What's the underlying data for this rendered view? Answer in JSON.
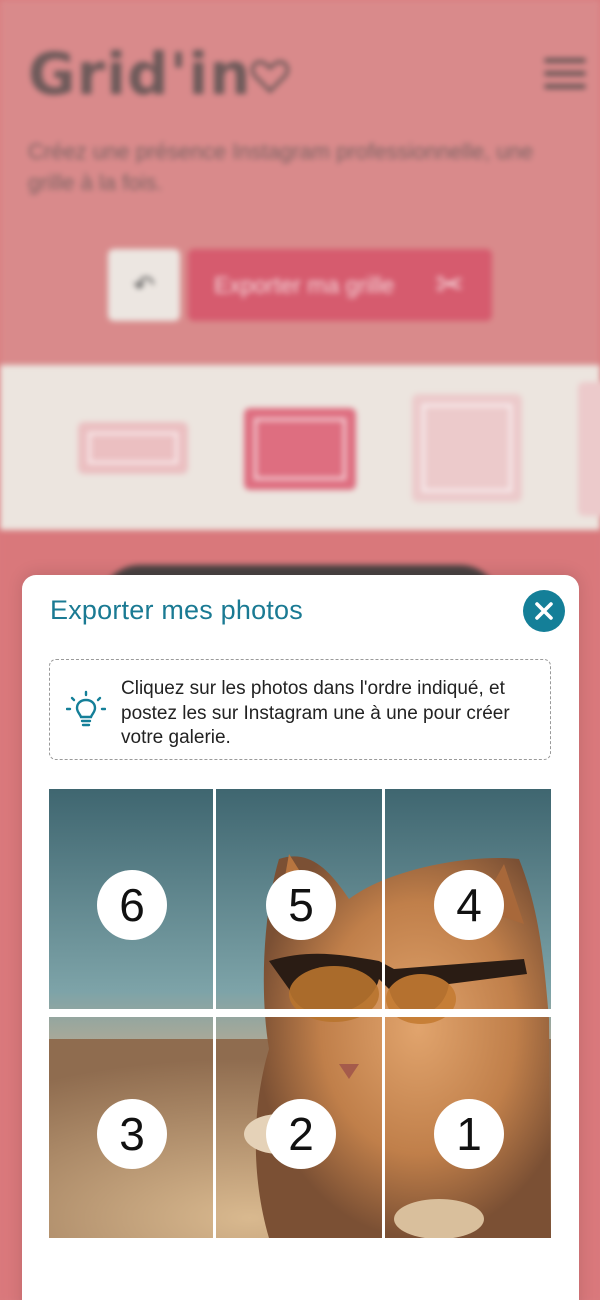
{
  "background": {
    "logo": "Grid'in",
    "tagline": "Créez une présence Instagram professionnelle, une grille à la fois.",
    "undo_icon": "undo-icon",
    "export_button_label": "Exporter ma grille",
    "export_icon": "scissors-icon",
    "layouts": [
      "1x3",
      "2x3",
      "3x3",
      "4x3"
    ]
  },
  "modal": {
    "title": "Exporter mes photos",
    "close_icon": "close-icon",
    "tip_icon": "lightbulb-icon",
    "tip_text": "Cliquez sur les photos dans l'ordre indiqué, et postez les sur Instagram une à une pour créer votre galerie.",
    "photo_order": [
      {
        "row": 1,
        "col": 1,
        "label": "6"
      },
      {
        "row": 1,
        "col": 2,
        "label": "5"
      },
      {
        "row": 1,
        "col": 3,
        "label": "4"
      },
      {
        "row": 2,
        "col": 1,
        "label": "3"
      },
      {
        "row": 2,
        "col": 2,
        "label": "2"
      },
      {
        "row": 2,
        "col": 3,
        "label": "1"
      }
    ]
  },
  "colors": {
    "accent": "#147f98",
    "title": "#1a7a93",
    "backdrop": "#d97b7e",
    "export_button": "#d65b6e"
  }
}
